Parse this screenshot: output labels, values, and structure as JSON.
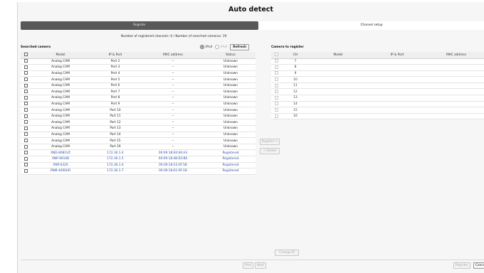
{
  "title": "Auto detect",
  "tabs": [
    {
      "label": "Register",
      "active": true
    },
    {
      "label": "Channel setup",
      "active": false
    }
  ],
  "info": "Number of registered channels: 6 / Number of searched cameras: 19",
  "searched": {
    "label": "Searched camera",
    "ip_options": [
      {
        "label": "IPv4",
        "selected": true,
        "enabled": true
      },
      {
        "label": "IPv6",
        "selected": false,
        "enabled": false
      }
    ],
    "refresh_label": "Refresh",
    "columns": [
      "Model",
      "IP & Port",
      "MAC address",
      "Status"
    ],
    "rows": [
      {
        "model": "Analog CAM",
        "ip": "Port 2",
        "mac": "--",
        "status": "Unknown"
      },
      {
        "model": "Analog CAM",
        "ip": "Port 3",
        "mac": "--",
        "status": "Unknown"
      },
      {
        "model": "Analog CAM",
        "ip": "Port 4",
        "mac": "--",
        "status": "Unknown"
      },
      {
        "model": "Analog CAM",
        "ip": "Port 5",
        "mac": "--",
        "status": "Unknown"
      },
      {
        "model": "Analog CAM",
        "ip": "Port 6",
        "mac": "--",
        "status": "Unknown"
      },
      {
        "model": "Analog CAM",
        "ip": "Port 7",
        "mac": "--",
        "status": "Unknown"
      },
      {
        "model": "Analog CAM",
        "ip": "Port 8",
        "mac": "--",
        "status": "Unknown"
      },
      {
        "model": "Analog CAM",
        "ip": "Port 9",
        "mac": "--",
        "status": "Unknown"
      },
      {
        "model": "Analog CAM",
        "ip": "Port 10",
        "mac": "--",
        "status": "Unknown"
      },
      {
        "model": "Analog CAM",
        "ip": "Port 11",
        "mac": "--",
        "status": "Unknown"
      },
      {
        "model": "Analog CAM",
        "ip": "Port 12",
        "mac": "--",
        "status": "Unknown"
      },
      {
        "model": "Analog CAM",
        "ip": "Port 13",
        "mac": "--",
        "status": "Unknown"
      },
      {
        "model": "Analog CAM",
        "ip": "Port 14",
        "mac": "--",
        "status": "Unknown"
      },
      {
        "model": "Analog CAM",
        "ip": "Port 15",
        "mac": "--",
        "status": "Unknown"
      },
      {
        "model": "Analog CAM",
        "ip": "Port 16",
        "mac": "--",
        "status": "Unknown"
      },
      {
        "model": "XND-8081VZ",
        "ip": "172.30.1.4",
        "mac": "00:09:18:E0:94:A3",
        "status": "Registered"
      },
      {
        "model": "XNP-9610B",
        "ip": "172.30.1.5",
        "mac": "00:09:18:4B:E0:B0",
        "status": "Registered"
      },
      {
        "model": "XNP-6320",
        "ip": "172.30.1.6",
        "mac": "00:09:18:52:0F:5B",
        "status": "Registered"
      },
      {
        "model": "PNM-4000UR",
        "ip": "172.30.1.7",
        "mac": "00:09:18:61:9F:1B",
        "status": "Registered"
      }
    ]
  },
  "register_btn": "Register >",
  "delete_btn": "< Delete",
  "to_register": {
    "label": "Camera to register",
    "columns": [
      "CH",
      "Model",
      "IP & Port",
      "MAC address"
    ],
    "rows": [
      {
        "ch": "7"
      },
      {
        "ch": "8"
      },
      {
        "ch": "9"
      },
      {
        "ch": "10"
      },
      {
        "ch": "11"
      },
      {
        "ch": "12"
      },
      {
        "ch": "13"
      },
      {
        "ch": "14"
      },
      {
        "ch": "15"
      },
      {
        "ch": "16"
      }
    ]
  },
  "change_ip": "Change IP",
  "footer": {
    "prev": "Prev",
    "next": "Next",
    "register": "Register",
    "cancel": "Cancel"
  }
}
